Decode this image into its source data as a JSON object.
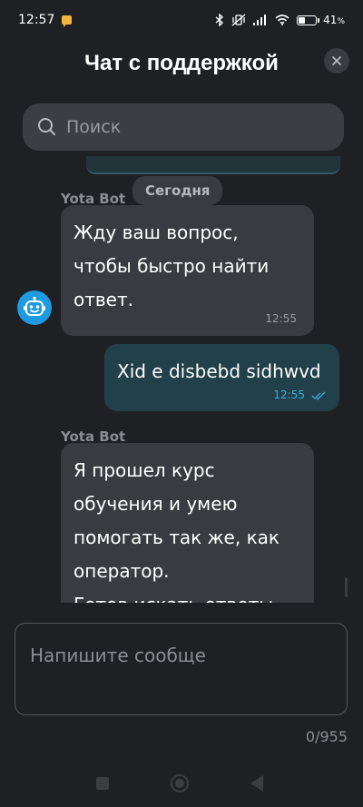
{
  "status_bar": {
    "time": "12:57",
    "battery_percent": "41",
    "battery_percent_suffix": "%",
    "battery_level": 0.41
  },
  "header": {
    "title": "Чат с поддержкой"
  },
  "search": {
    "placeholder": "Поиск"
  },
  "chat": {
    "date_divider": "Сегодня",
    "messages": [
      {
        "direction": "incoming",
        "sender": "Yota Bot",
        "text": "Жду ваш вопрос,\nчтобы быстро найти\nответ.",
        "time": "12:55"
      },
      {
        "direction": "outgoing",
        "text": "Xid e disbebd sidhwvd",
        "time": "12:55",
        "status": "read"
      },
      {
        "direction": "incoming",
        "sender": "Yota Bot",
        "text": "Я прошел курс\nобучения и умею\nпомогать так же, как\nоператор.\nГотов искать ответы.",
        "time": ""
      }
    ]
  },
  "composer": {
    "placeholder": "Напишите сообще",
    "char_counter": "0/955"
  },
  "colors": {
    "background": "#1f2023",
    "incoming_bubble": "#3a3b40",
    "outgoing_bubble": "#22404a",
    "accent": "#39aedc",
    "bot_avatar": "#1e9be0"
  },
  "icons": {
    "search": "search-icon",
    "close": "close-icon",
    "bot": "robot-icon",
    "read_receipt": "double-check-icon"
  }
}
